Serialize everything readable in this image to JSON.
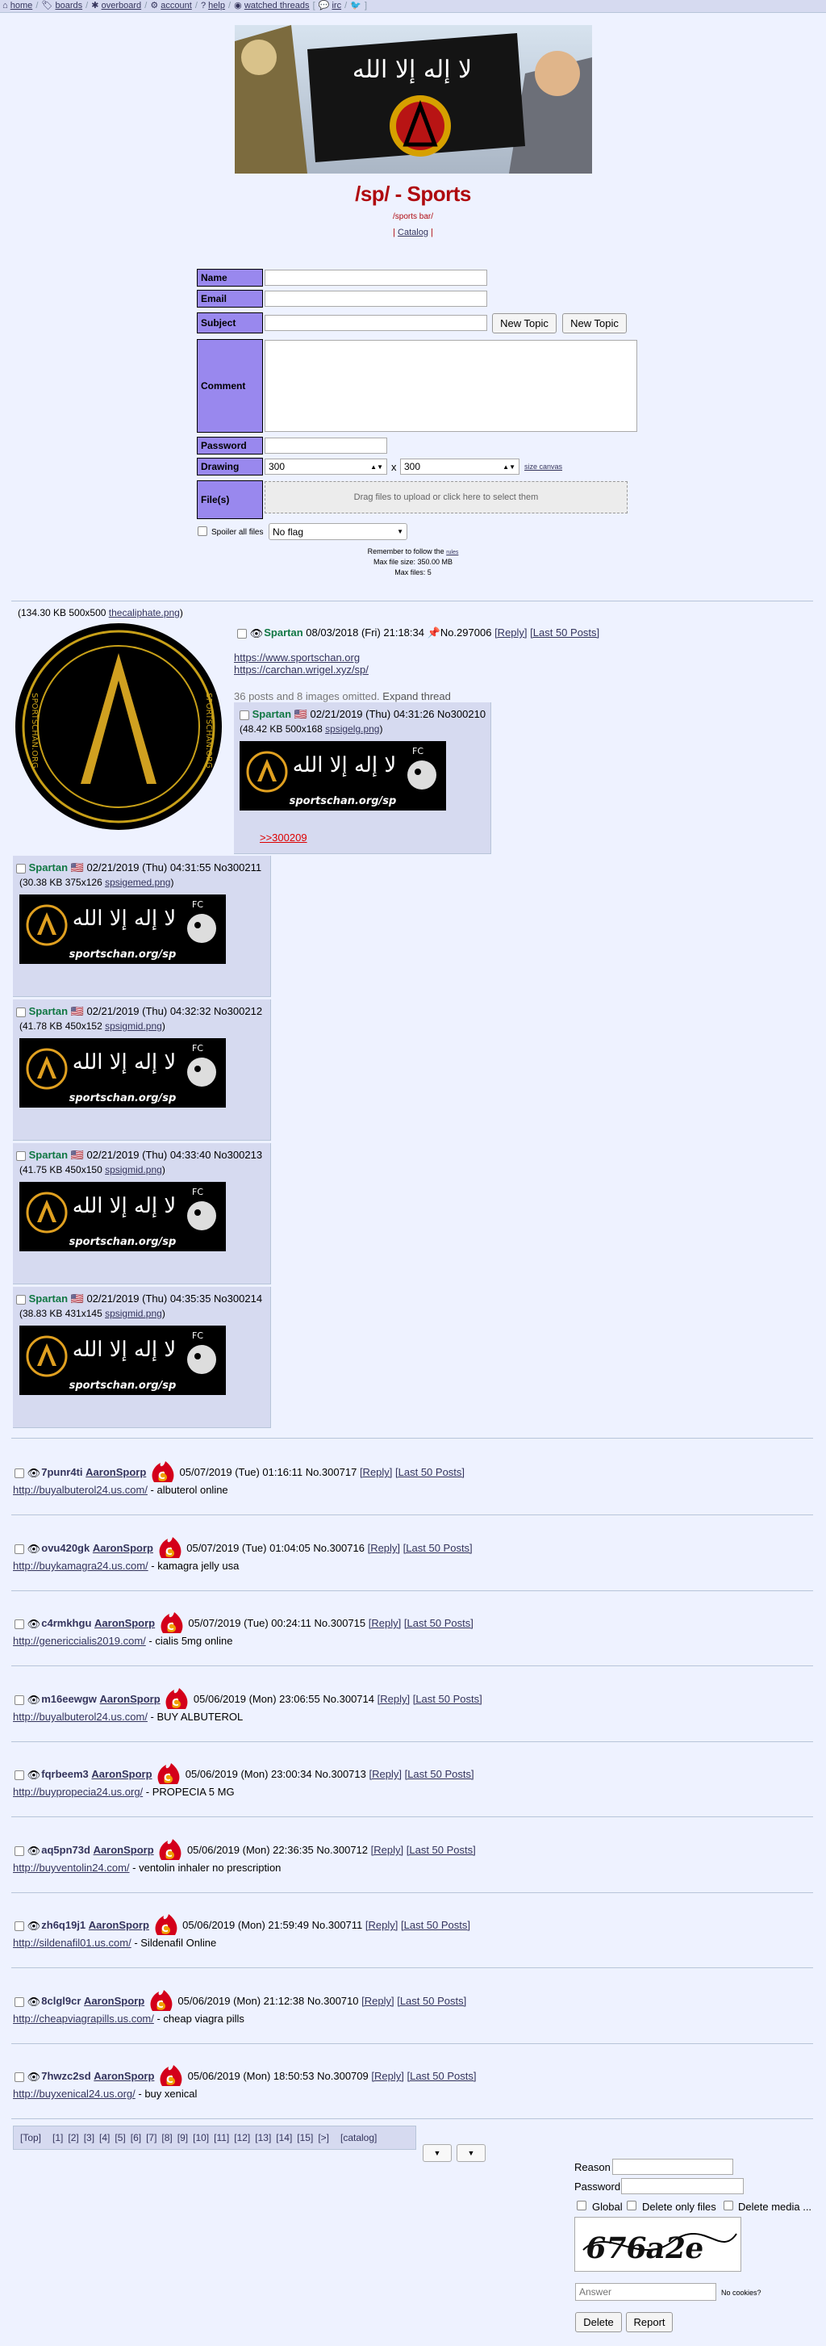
{
  "topbar": {
    "items": [
      "home",
      "boards",
      "overboard",
      "account",
      "help",
      "watched threads",
      "irc"
    ]
  },
  "board": {
    "title": "/sp/ - Sports",
    "subtitle": "/sports bar/",
    "catalog": "Catalog"
  },
  "form": {
    "name_label": "Name",
    "email_label": "Email",
    "subject_label": "Subject",
    "new_topic_1": "New Topic",
    "new_topic_2": "New Topic",
    "comment_label": "Comment",
    "password_label": "Password",
    "drawing_label": "Drawing",
    "drawing_w": "300",
    "drawing_x": "x",
    "drawing_h": "300",
    "size_canvas": "size canvas",
    "files_label": "File(s)",
    "drop_text": "Drag files to upload or click here to select them",
    "spoiler_label": "Spoiler all files",
    "flag_value": "No flag",
    "rules_prefix": "Remember to follow the",
    "rules_link": "rules",
    "max_size": "Max file size: 350.00 MB",
    "max_files": "Max files: 5"
  },
  "op": {
    "file": "(134.30 KB 500x500",
    "filename": "thecaliphate.png",
    "file_close": ")",
    "name": "Spartan",
    "date": "08/03/2018 (Fri) 21:18:34",
    "no": "No.297006",
    "reply": "[Reply]",
    "last50": "[Last 50 Posts]",
    "link1": "https://www.sportschan.org",
    "link2": "https://carchan.wrigel.xyz/sp/",
    "omitted": "36 posts and 8 images omitted.",
    "expand": "Expand thread"
  },
  "replies": [
    {
      "name": "Spartan",
      "date": "02/21/2019 (Thu) 04:31:26",
      "no": "No300210",
      "file": "(48.42 KB 500x168",
      "filename": "spsigelg.png",
      "quote": ">>300209"
    },
    {
      "name": "Spartan",
      "date": "02/21/2019 (Thu) 04:31:55",
      "no": "No300211",
      "file": "(30.38 KB 375x126",
      "filename": "spsigemed.png"
    },
    {
      "name": "Spartan",
      "date": "02/21/2019 (Thu) 04:32:32",
      "no": "No300212",
      "file": "(41.78 KB 450x152",
      "filename": "spsigmid.png"
    },
    {
      "name": "Spartan",
      "date": "02/21/2019 (Thu) 04:33:40",
      "no": "No300213",
      "file": "(41.75 KB 450x150",
      "filename": "spsigmid.png"
    },
    {
      "name": "Spartan",
      "date": "02/21/2019 (Thu) 04:35:35",
      "no": "No300214",
      "file": "(38.83 KB 431x145",
      "filename": "spsigmid.png"
    }
  ],
  "banner_text": "sportschan.org/sp",
  "op_emblem_text": "SPORTSCHAN.ORG",
  "spam": [
    {
      "subject": "7punr4ti",
      "name": "AaronSporp",
      "date": "05/07/2019 (Tue) 01:16:11",
      "no": "No.300717",
      "link": "http://buyalbuterol24.us.com/",
      "text": " - albuterol online"
    },
    {
      "subject": "ovu420gk",
      "name": "AaronSporp",
      "date": "05/07/2019 (Tue) 01:04:05",
      "no": "No.300716",
      "link": "http://buykamagra24.us.com/",
      "text": " - kamagra jelly usa"
    },
    {
      "subject": "c4rmkhgu",
      "name": "AaronSporp",
      "date": "05/07/2019 (Tue) 00:24:11",
      "no": "No.300715",
      "link": "http://genericcialis2019.com/",
      "text": " - cialis 5mg online"
    },
    {
      "subject": "m16eewgw",
      "name": "AaronSporp",
      "date": "05/06/2019 (Mon) 23:06:55",
      "no": "No.300714",
      "link": "http://buyalbuterol24.us.com/",
      "text": " - BUY ALBUTEROL"
    },
    {
      "subject": "fqrbeem3",
      "name": "AaronSporp",
      "date": "05/06/2019 (Mon) 23:00:34",
      "no": "No.300713",
      "link": "http://buypropecia24.us.org/",
      "text": " - PROPECIA 5 MG"
    },
    {
      "subject": "aq5pn73d",
      "name": "AaronSporp",
      "date": "05/06/2019 (Mon) 22:36:35",
      "no": "No.300712",
      "link": "http://buyventolin24.com/",
      "text": " - ventolin inhaler no prescription"
    },
    {
      "subject": "zh6q19j1",
      "name": "AaronSporp",
      "date": "05/06/2019 (Mon) 21:59:49",
      "no": "No.300711",
      "link": "http://sildenafil01.us.com/",
      "text": " - Sildenafil Online"
    },
    {
      "subject": "8clgl9cr",
      "name": "AaronSporp",
      "date": "05/06/2019 (Mon) 21:12:38",
      "no": "No.300710",
      "link": "http://cheapviagrapills.us.com/",
      "text": " - cheap viagra pills"
    },
    {
      "subject": "7hwzc2sd",
      "name": "AaronSporp",
      "date": "05/06/2019 (Mon) 18:50:53",
      "no": "No.300709",
      "link": "http://buyxenical24.us.org/",
      "text": " - buy xenical"
    }
  ],
  "thread_actions": {
    "reply": "[Reply]",
    "last50": "[Last 50 Posts]"
  },
  "pager": {
    "top": "[Top]",
    "pages": [
      "[1]",
      "[2]",
      "[3]",
      "[4]",
      "[5]",
      "[6]",
      "[7]",
      "[8]",
      "[9]",
      "[10]",
      "[11]",
      "[12]",
      "[13]",
      "[14]",
      "[15]",
      "[>]"
    ],
    "catalog": "[catalog]"
  },
  "mod": {
    "reason": "Reason",
    "password": "Password",
    "global": "Global",
    "delete_only_files": "Delete only files",
    "delete_media": "Delete media ...",
    "captcha_text": "676a2e",
    "answer_placeholder": "Answer",
    "no_cookies": "No cookies?",
    "delete": "Delete",
    "report": "Report"
  },
  "colors": {
    "bg": "#eef2ff",
    "post": "#d6daf0",
    "name": "#117743",
    "title": "#af0a0f",
    "label": "#9988ee"
  }
}
